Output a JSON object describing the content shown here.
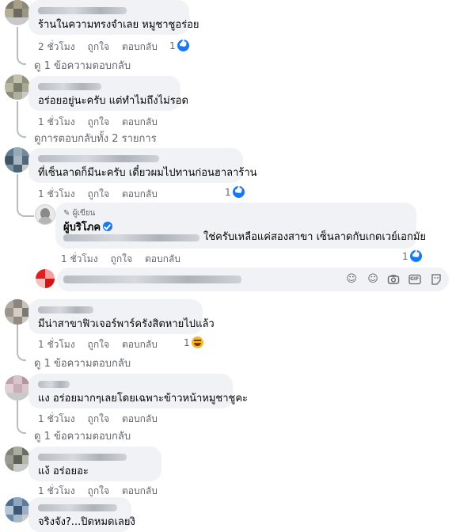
{
  "comments": [
    {
      "text": "ร้านในความทรงจำเลย หมูชาชูอร่อย",
      "time": "2 ชั่วโมง",
      "like": "ถูกใจ",
      "reply": "ตอบกลับ",
      "reactions": "1",
      "view_replies": "ดู 1 ข้อความตอบกลับ"
    },
    {
      "text": "อร่อยอยู่นะครับ แต่ทำไมถึงไม่รอด",
      "time": "1 ชั่วโมง",
      "like": "ถูกใจ",
      "reply": "ตอบกลับ",
      "view_replies": "ดูการตอบกลับทั้ง 2 รายการ"
    },
    {
      "text": "ที่เซ็นลาดก็มีนะครับ เดี๋ยวผมไปทานก่อนฮาลาร้าน",
      "time": "1 ชั่วโมง",
      "like": "ถูกใจ",
      "reply": "ตอบกลับ",
      "reactions": "1"
    },
    {
      "text": "มีน่าสาขาฟิวเจอร์พาร์ครังสิตหายไปแล้ว",
      "time": "1 ชั่วโมง",
      "like": "ถูกใจ",
      "reply": "ตอบกลับ",
      "reactions": "1",
      "view_replies": "ดู 1 ข้อความตอบกลับ"
    },
    {
      "text": "แง อร่อยมากๆเลยโดยเฉพาะข้าวหน้าหมูชาชูคะ",
      "time": "1 ชั่วโมง",
      "like": "ถูกใจ",
      "reply": "ตอบกลับ",
      "view_replies": "ดู 1 ข้อความตอบกลับ"
    },
    {
      "text": "แง้ อร่อยอะ",
      "time": "1 ชั่วโมง",
      "like": "ถูกใจ",
      "reply": "ตอบกลับ"
    },
    {
      "text": "จริงจัง?...ปิดหมดเลยงิ"
    }
  ],
  "author_reply": {
    "author_label": "ผู้เขียน",
    "name": "ผู้บริโภค",
    "text": "ใช่ครับเหลือแค่สองสาขา เซ็นลาดกับเกตเวย์เอกมัย",
    "time": "1 ชั่วโมง",
    "like": "ถูกใจ",
    "reply": "ตอบกลับ",
    "reactions": "1"
  },
  "composer_icons": [
    "sticker-face-icon",
    "emoji-icon",
    "camera-icon",
    "gif-icon",
    "sticker-icon"
  ],
  "composer_gif_label": "GIF",
  "colors": {
    "bubble": "#f0f2f5",
    "secondary_text": "#65676b",
    "like_blue": "#1877f2",
    "haha_yellow": "#f7b928"
  }
}
